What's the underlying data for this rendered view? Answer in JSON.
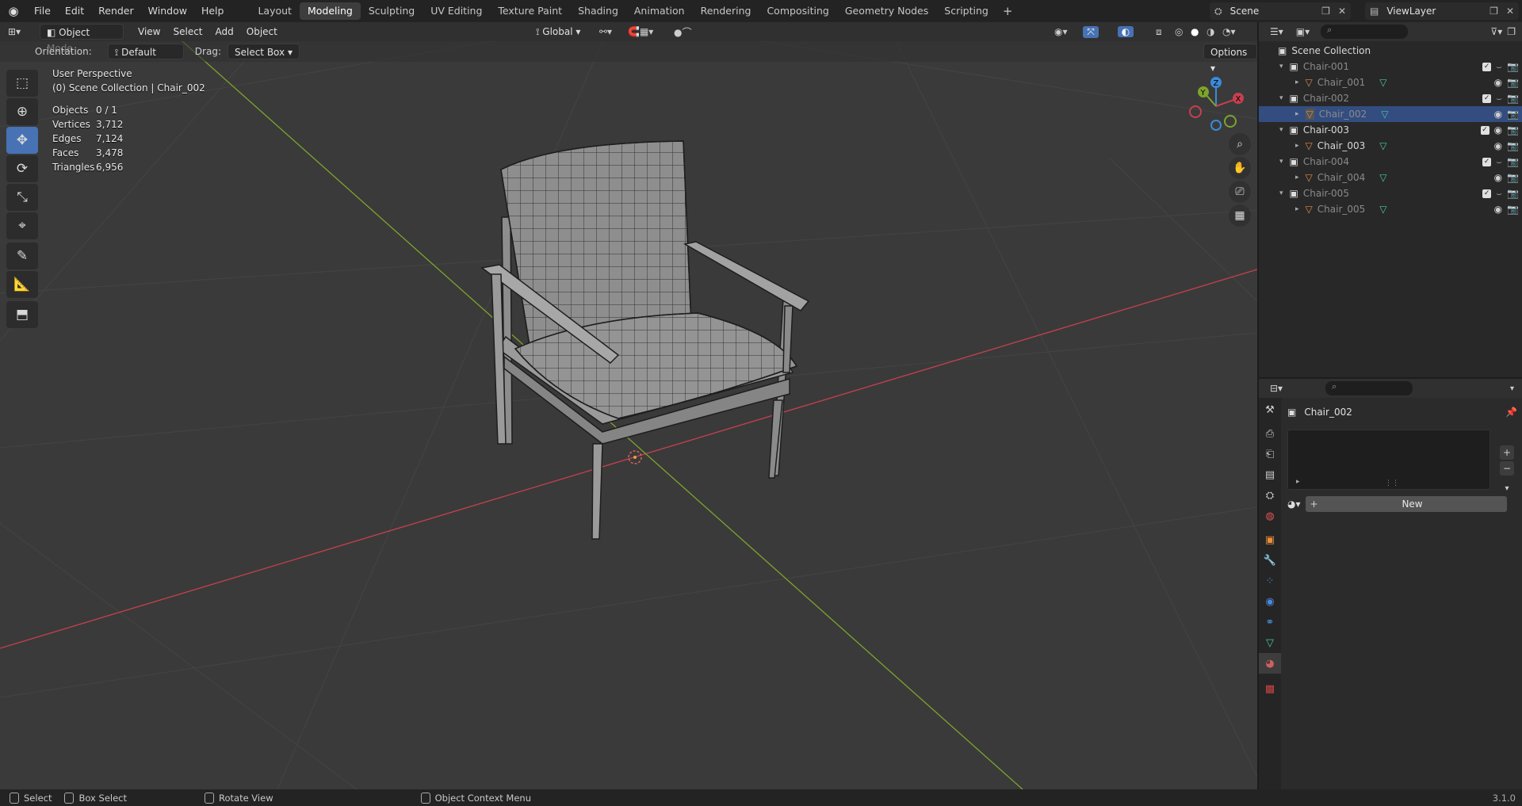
{
  "menu": [
    "File",
    "Edit",
    "Render",
    "Window",
    "Help"
  ],
  "workspaces": [
    "Layout",
    "Modeling",
    "Sculpting",
    "UV Editing",
    "Texture Paint",
    "Shading",
    "Animation",
    "Rendering",
    "Compositing",
    "Geometry Nodes",
    "Scripting"
  ],
  "active_workspace": "Modeling",
  "scene_name": "Scene",
  "view_layer": "ViewLayer",
  "viewport_header": {
    "mode": "Object Mode",
    "menus": [
      "View",
      "Select",
      "Add",
      "Object"
    ],
    "transform_orientation": "Global",
    "orientation_label": "Orientation:",
    "orientation_value": "Default",
    "drag_label": "Drag:",
    "drag_value": "Select Box",
    "options_label": "Options"
  },
  "viewport_overlay": {
    "view_name": "User Perspective",
    "collection_path": "(0) Scene Collection | Chair_002",
    "stats": [
      {
        "label": "Objects",
        "value": "0 / 1"
      },
      {
        "label": "Vertices",
        "value": "3,712"
      },
      {
        "label": "Edges",
        "value": "7,124"
      },
      {
        "label": "Faces",
        "value": "3,478"
      },
      {
        "label": "Triangles",
        "value": "6,956"
      }
    ]
  },
  "outliner": {
    "root": "Scene Collection",
    "rows": [
      {
        "name": "Chair-001",
        "type": "collection",
        "dim": true
      },
      {
        "name": "Chair_001",
        "type": "mesh",
        "dim": true
      },
      {
        "name": "Chair-002",
        "type": "collection",
        "dim": true
      },
      {
        "name": "Chair_002",
        "type": "mesh",
        "dim": true,
        "selected": true
      },
      {
        "name": "Chair-003",
        "type": "collection",
        "dim": false
      },
      {
        "name": "Chair_003",
        "type": "mesh",
        "dim": false
      },
      {
        "name": "Chair-004",
        "type": "collection",
        "dim": true
      },
      {
        "name": "Chair_004",
        "type": "mesh",
        "dim": true
      },
      {
        "name": "Chair-005",
        "type": "collection",
        "dim": true
      },
      {
        "name": "Chair_005",
        "type": "mesh",
        "dim": true
      }
    ]
  },
  "properties": {
    "object_name": "Chair_002",
    "new_button": "New"
  },
  "statusbar": {
    "select": "Select",
    "box_select": "Box Select",
    "rotate_view": "Rotate View",
    "context_menu": "Object Context Menu",
    "version": "3.1.0"
  },
  "colors": {
    "accent": "#4772b3",
    "x_axis": "#c7404f",
    "y_axis": "#7da42c",
    "z_axis": "#3b8ad9",
    "selection": "#334d80"
  }
}
